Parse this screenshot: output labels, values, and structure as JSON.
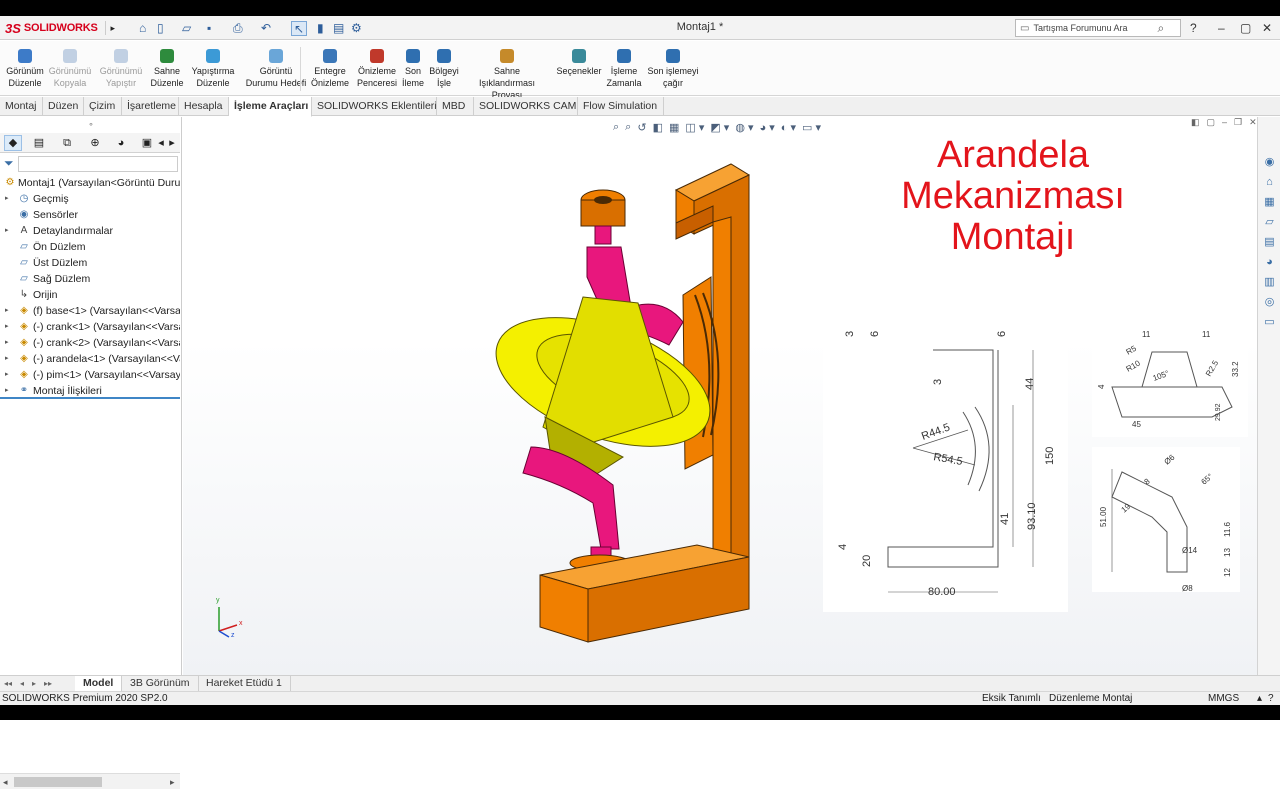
{
  "app": {
    "brand_mark": "3S",
    "brand_text": "SOLIDWORKS",
    "document_title": "Montaj1 *"
  },
  "titlebar": {
    "search_placeholder": "Tartışma Forumunu Ara"
  },
  "ribbon": {
    "buttons": [
      {
        "label": "Görünüm\nDüzenle",
        "disabled": false,
        "color": "#3d7bc8"
      },
      {
        "label": "Görünümü\nKopyala",
        "disabled": true,
        "color": "#7a9cc6"
      },
      {
        "label": "Görünümü\nYapıştır",
        "disabled": true,
        "color": "#7a9cc6"
      },
      {
        "label": "Sahne\nDüzenle",
        "disabled": false,
        "color": "#2e8b3d"
      },
      {
        "label": "Yapıştırma\nDüzenle",
        "disabled": false,
        "color": "#3c9ad6"
      },
      {
        "label": "Görüntü\nDurumu Hedefi",
        "disabled": false,
        "color": "#6aa6d8"
      },
      {
        "label": "Entegre\nÖnizleme",
        "disabled": false,
        "color": "#3b77b8"
      },
      {
        "label": "Önizleme\nPenceresi",
        "disabled": false,
        "color": "#c0392b"
      },
      {
        "label": "Son\nİleme",
        "disabled": false,
        "color": "#2f6fb0"
      },
      {
        "label": "Bölgeyi\nİşle",
        "disabled": false,
        "color": "#2f6fb0"
      },
      {
        "label": "Sahne Işıklandırması\nProvası",
        "disabled": false,
        "color": "#c58a2a"
      },
      {
        "label": "Seçenekler",
        "disabled": false,
        "color": "#3a8a9a"
      },
      {
        "label": "İşleme\nZamanla",
        "disabled": false,
        "color": "#2f6fb0"
      },
      {
        "label": "Son işlemeyi\nçağır",
        "disabled": false,
        "color": "#2f6fb0"
      }
    ]
  },
  "command_tabs": [
    "Montaj",
    "Düzen",
    "Çizim",
    "İşaretleme",
    "Hesapla",
    "İşleme Araçları",
    "SOLIDWORKS Eklentileri",
    "MBD",
    "SOLIDWORKS CAM",
    "Flow Simulation"
  ],
  "feature_tree": {
    "items": [
      {
        "label": "Montaj1  (Varsayılan<Görüntü Durumu",
        "icon": "assembly-icon",
        "expand": false,
        "indent": 0
      },
      {
        "label": "Geçmiş",
        "icon": "history-icon",
        "expand": true,
        "indent": 1
      },
      {
        "label": "Sensörler",
        "icon": "sensor-icon",
        "expand": false,
        "indent": 1
      },
      {
        "label": "Detaylandırmalar",
        "icon": "annotation-icon",
        "expand": true,
        "indent": 1
      },
      {
        "label": "Ön Düzlem",
        "icon": "plane-icon",
        "expand": false,
        "indent": 1
      },
      {
        "label": "Üst Düzlem",
        "icon": "plane-icon",
        "expand": false,
        "indent": 1
      },
      {
        "label": "Sağ Düzlem",
        "icon": "plane-icon",
        "expand": false,
        "indent": 1
      },
      {
        "label": "Orijin",
        "icon": "origin-icon",
        "expand": false,
        "indent": 1
      },
      {
        "label": "(f) base<1> (Varsayılan<<Varsayıl",
        "icon": "part-icon",
        "expand": true,
        "indent": 1
      },
      {
        "label": "(-) crank<1> (Varsayılan<<Varsay",
        "icon": "part-icon",
        "expand": true,
        "indent": 1
      },
      {
        "label": "(-) crank<2> (Varsayılan<<Varsay",
        "icon": "part-icon",
        "expand": true,
        "indent": 1
      },
      {
        "label": "(-) arandela<1> (Varsayılan<<Va",
        "icon": "part-icon",
        "expand": true,
        "indent": 1
      },
      {
        "label": "(-) pim<1> (Varsayılan<<Varsayıl",
        "icon": "part-icon",
        "expand": true,
        "indent": 1
      },
      {
        "label": "Montaj İlişkileri",
        "icon": "mates-icon",
        "expand": true,
        "indent": 1
      }
    ]
  },
  "overlay_title": {
    "line1": "Arandela",
    "line2": "Mekanizması",
    "line3": "Montajı"
  },
  "drawing1": {
    "dims": [
      "3",
      "6",
      "6",
      "3",
      "44",
      "150",
      "R44.5",
      "R54.5",
      "4",
      "20",
      "41",
      "93.10",
      "80.00"
    ]
  },
  "drawing2": {
    "dims": [
      "11",
      "11",
      "R5",
      "R10",
      "105°",
      "R2.5",
      "33.2",
      "4",
      "45",
      "29.92"
    ]
  },
  "drawing3": {
    "dims": [
      "Ø6",
      "8",
      "65°",
      "19",
      "51.00",
      "11.6",
      "Ø14",
      "13",
      "12",
      "Ø8"
    ]
  },
  "triad": {
    "x": "x",
    "y": "y",
    "z": "z"
  },
  "bottom_tabs": [
    "Model",
    "3B Görünüm",
    "Hareket Etüdü 1"
  ],
  "status": {
    "left": "SOLIDWORKS Premium 2020 SP2.0",
    "s1": "Eksik Tanımlı",
    "s2": "Düzenleme Montaj",
    "s3": "MMGS"
  },
  "colors": {
    "accent_red": "#e3141b",
    "frame_orange": "#f07f00",
    "crank_magenta": "#e8177d",
    "washer_yellow": "#f4f000"
  }
}
